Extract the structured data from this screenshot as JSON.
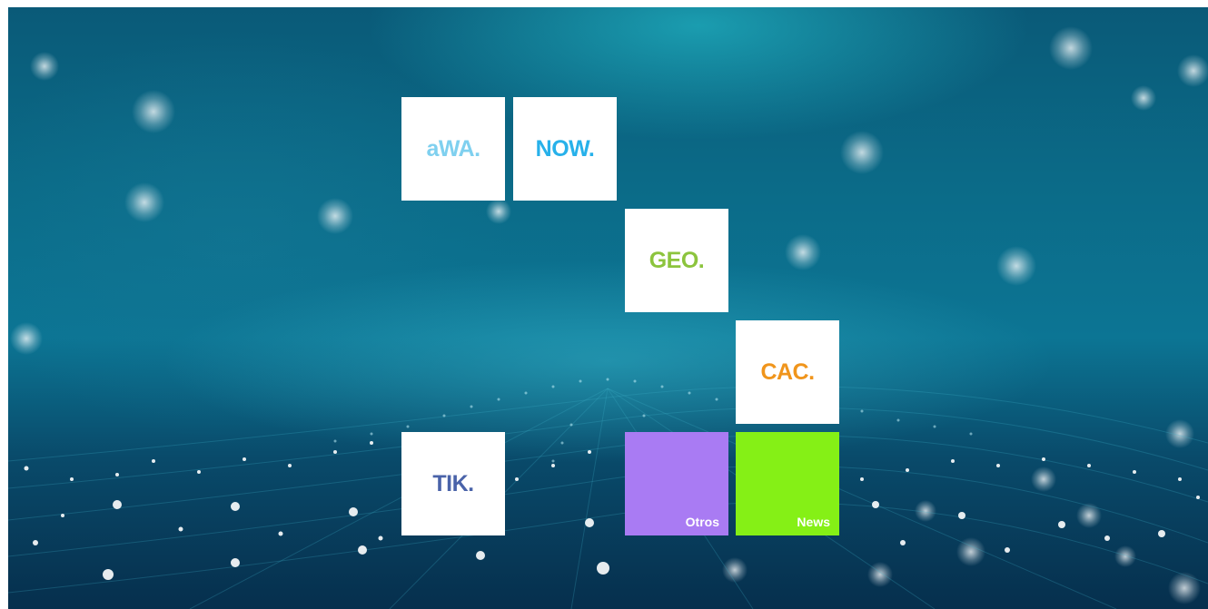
{
  "tiles": {
    "awa": {
      "label": "aWA.",
      "color": "#7fd0ef"
    },
    "now": {
      "label": "NOW.",
      "color": "#27b1ea"
    },
    "geo": {
      "label": "GEO.",
      "color": "#8cc43d"
    },
    "cac": {
      "label": "CAC.",
      "color": "#f0951c"
    },
    "tik": {
      "label": "TIK.",
      "color": "#4a63a9"
    },
    "otros": {
      "label": "Otros",
      "color": "#a97bf3"
    },
    "news": {
      "label": "News",
      "color": "#85f016"
    }
  }
}
